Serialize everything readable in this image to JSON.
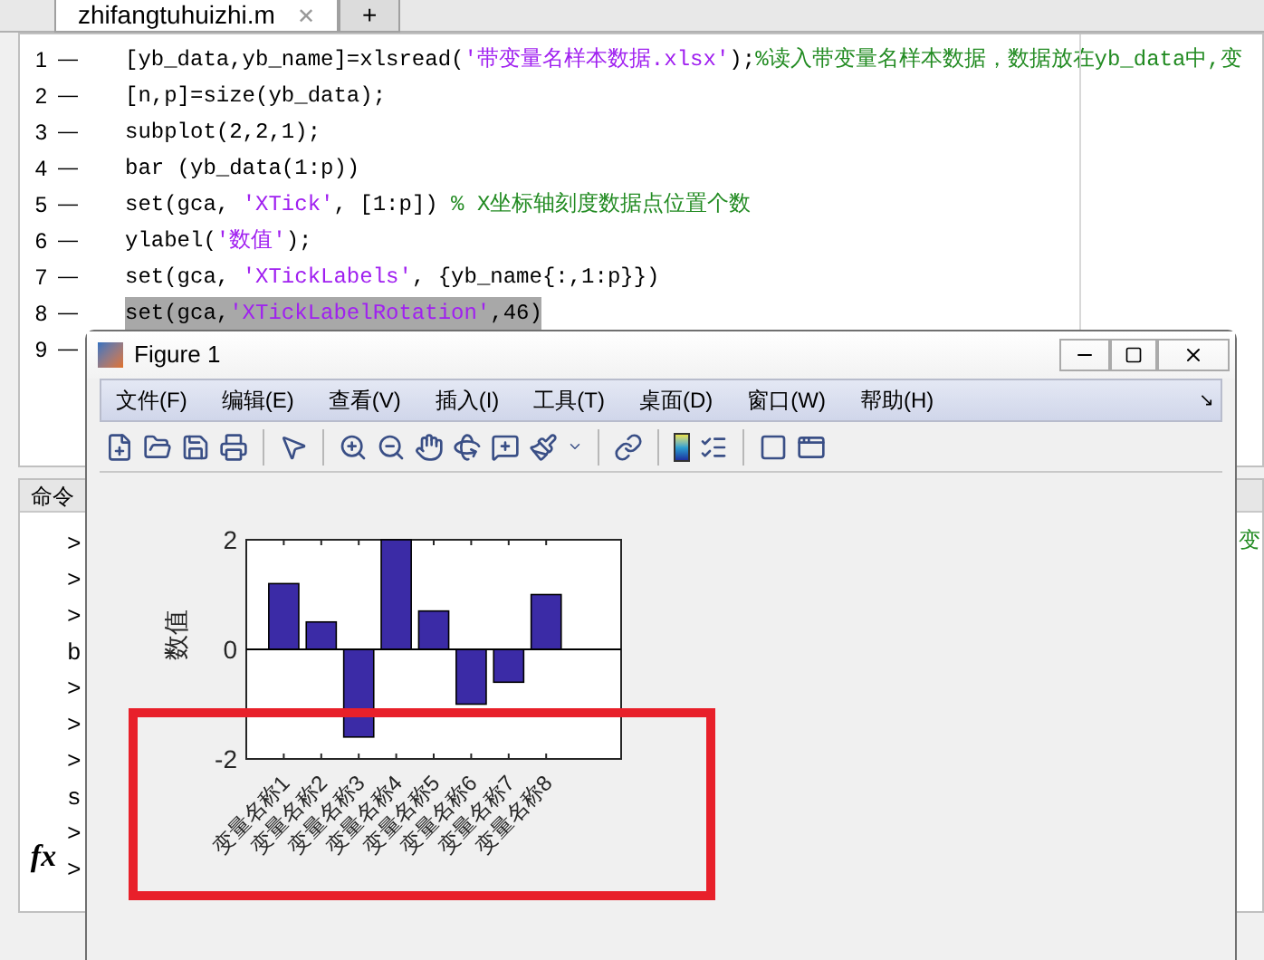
{
  "editor": {
    "tabs": [
      {
        "label": "zhifangtuhuizhi.m",
        "close": "✕",
        "selected": true
      },
      {
        "label": "+",
        "selected": false
      }
    ],
    "lines": [
      {
        "number": "1",
        "marker": "—",
        "highlighted": false,
        "segments": [
          {
            "kind": "code",
            "text": "[yb_data,yb_name]=xlsread("
          },
          {
            "kind": "string",
            "text": "'带变量名样本数据.xlsx'"
          },
          {
            "kind": "code",
            "text": ");"
          },
          {
            "kind": "comment",
            "text": "%读入带变量名样本数据，数据放在yb_data中,变"
          }
        ]
      },
      {
        "number": "2",
        "marker": "—",
        "highlighted": false,
        "segments": [
          {
            "kind": "code",
            "text": "[n,p]=size(yb_data);"
          }
        ]
      },
      {
        "number": "3",
        "marker": "—",
        "highlighted": false,
        "segments": [
          {
            "kind": "code",
            "text": "subplot(2,2,1);"
          }
        ]
      },
      {
        "number": "4",
        "marker": "—",
        "highlighted": false,
        "segments": [
          {
            "kind": "code",
            "text": "bar (yb_data(1:p))"
          }
        ]
      },
      {
        "number": "5",
        "marker": "—",
        "highlighted": false,
        "segments": [
          {
            "kind": "code",
            "text": "set(gca, "
          },
          {
            "kind": "string",
            "text": "'XTick'"
          },
          {
            "kind": "code",
            "text": ", [1:p]) "
          },
          {
            "kind": "comment",
            "text": "% X坐标轴刻度数据点位置个数"
          }
        ]
      },
      {
        "number": "6",
        "marker": "—",
        "highlighted": false,
        "segments": [
          {
            "kind": "code",
            "text": "ylabel("
          },
          {
            "kind": "string",
            "text": "'数值'"
          },
          {
            "kind": "code",
            "text": ");"
          }
        ]
      },
      {
        "number": "7",
        "marker": "—",
        "highlighted": false,
        "segments": [
          {
            "kind": "code",
            "text": "set(gca, "
          },
          {
            "kind": "string",
            "text": "'XTickLabels'"
          },
          {
            "kind": "code",
            "text": ", {yb_name{:,1:p}})"
          }
        ]
      },
      {
        "number": "8",
        "marker": "—",
        "highlighted": true,
        "segments": [
          {
            "kind": "code",
            "text": "set(gca,"
          },
          {
            "kind": "string",
            "text": "'XTickLabelRotation'"
          },
          {
            "kind": "code",
            "text": ",46)"
          }
        ]
      },
      {
        "number": "9",
        "marker": "—",
        "highlighted": false
      }
    ]
  },
  "command_window": {
    "title": "命令",
    "lines": [
      ">",
      ">",
      ">",
      "b",
      ">",
      ">",
      ">",
      "s",
      ">",
      ">"
    ],
    "prompt_icon": "fx",
    "right_text": "变"
  },
  "figure": {
    "title": "Figure 1",
    "menu": [
      "文件(F)",
      "编辑(E)",
      "查看(V)",
      "插入(I)",
      "工具(T)",
      "桌面(D)",
      "窗口(W)",
      "帮助(H)"
    ],
    "menu_arrow": "↘",
    "chart_data": {
      "type": "bar",
      "ylabel": "数值",
      "categories": [
        "变量名称1",
        "变量名称2",
        "变量名称3",
        "变量名称4",
        "变量名称5",
        "变量名称6",
        "变量名称7",
        "变量名称8"
      ],
      "series": [
        {
          "color": "#3b2ba6",
          "values": [
            1.2,
            0.5,
            -1.6,
            2,
            0.7,
            -1,
            -0.6,
            1
          ]
        }
      ],
      "ylim": [
        -2,
        2
      ],
      "yticks": [
        -2,
        0,
        2
      ]
    }
  }
}
